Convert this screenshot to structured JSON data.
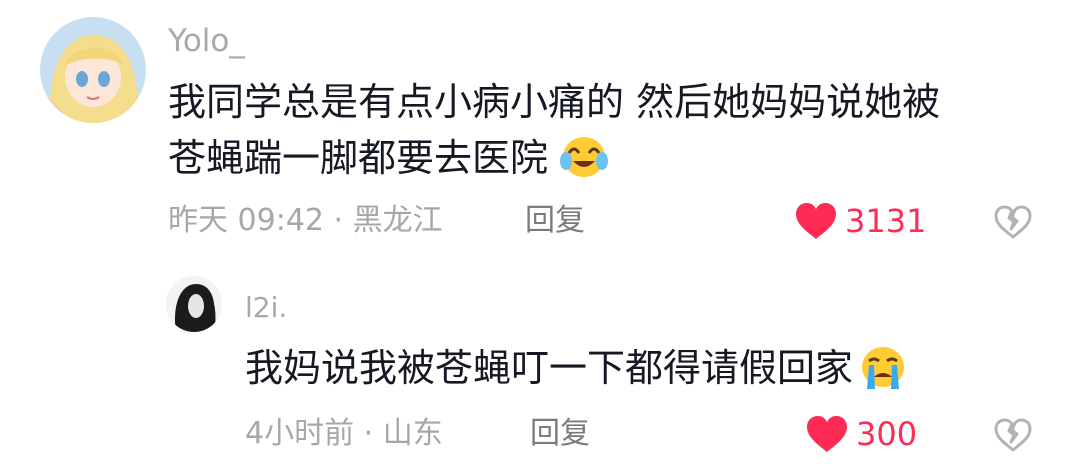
{
  "comments": [
    {
      "username": "Yolo_",
      "lines": [
        "我同学总是有点小病小痛的 然后她妈妈说她被",
        "苍蝇踹一脚都要去医院"
      ],
      "meta": "昨天 09:42 · 黑龙江",
      "reply_label": "回复",
      "like_count": "3131",
      "emoji": "laughing-crying-emoji"
    },
    {
      "username": "l2i.",
      "lines": [
        "我妈说我被苍蝇叮一下都得请假回家"
      ],
      "meta": "4小时前 · 山东",
      "reply_label": "回复",
      "like_count": "300",
      "emoji": "crying-emoji"
    }
  ],
  "colors": {
    "accent": "#fe2c55",
    "muted": "#a7a7a7",
    "text": "#161823"
  },
  "icons": {
    "like": "heart-icon",
    "dislike": "broken-heart-icon"
  }
}
